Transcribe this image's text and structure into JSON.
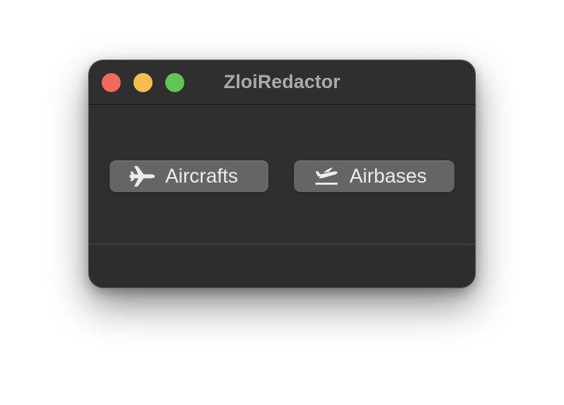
{
  "window": {
    "title": "ZloiRedactor"
  },
  "buttons": {
    "aircrafts": {
      "label": "Aircrafts",
      "icon": "airplane-icon"
    },
    "airbases": {
      "label": "Airbases",
      "icon": "airplane-departure-icon"
    }
  },
  "colors": {
    "window_bg": "#2f2f2f",
    "button_bg": "#656565",
    "close": "#ec6a5e",
    "minimize": "#f4bf4f",
    "maximize": "#61c554"
  }
}
